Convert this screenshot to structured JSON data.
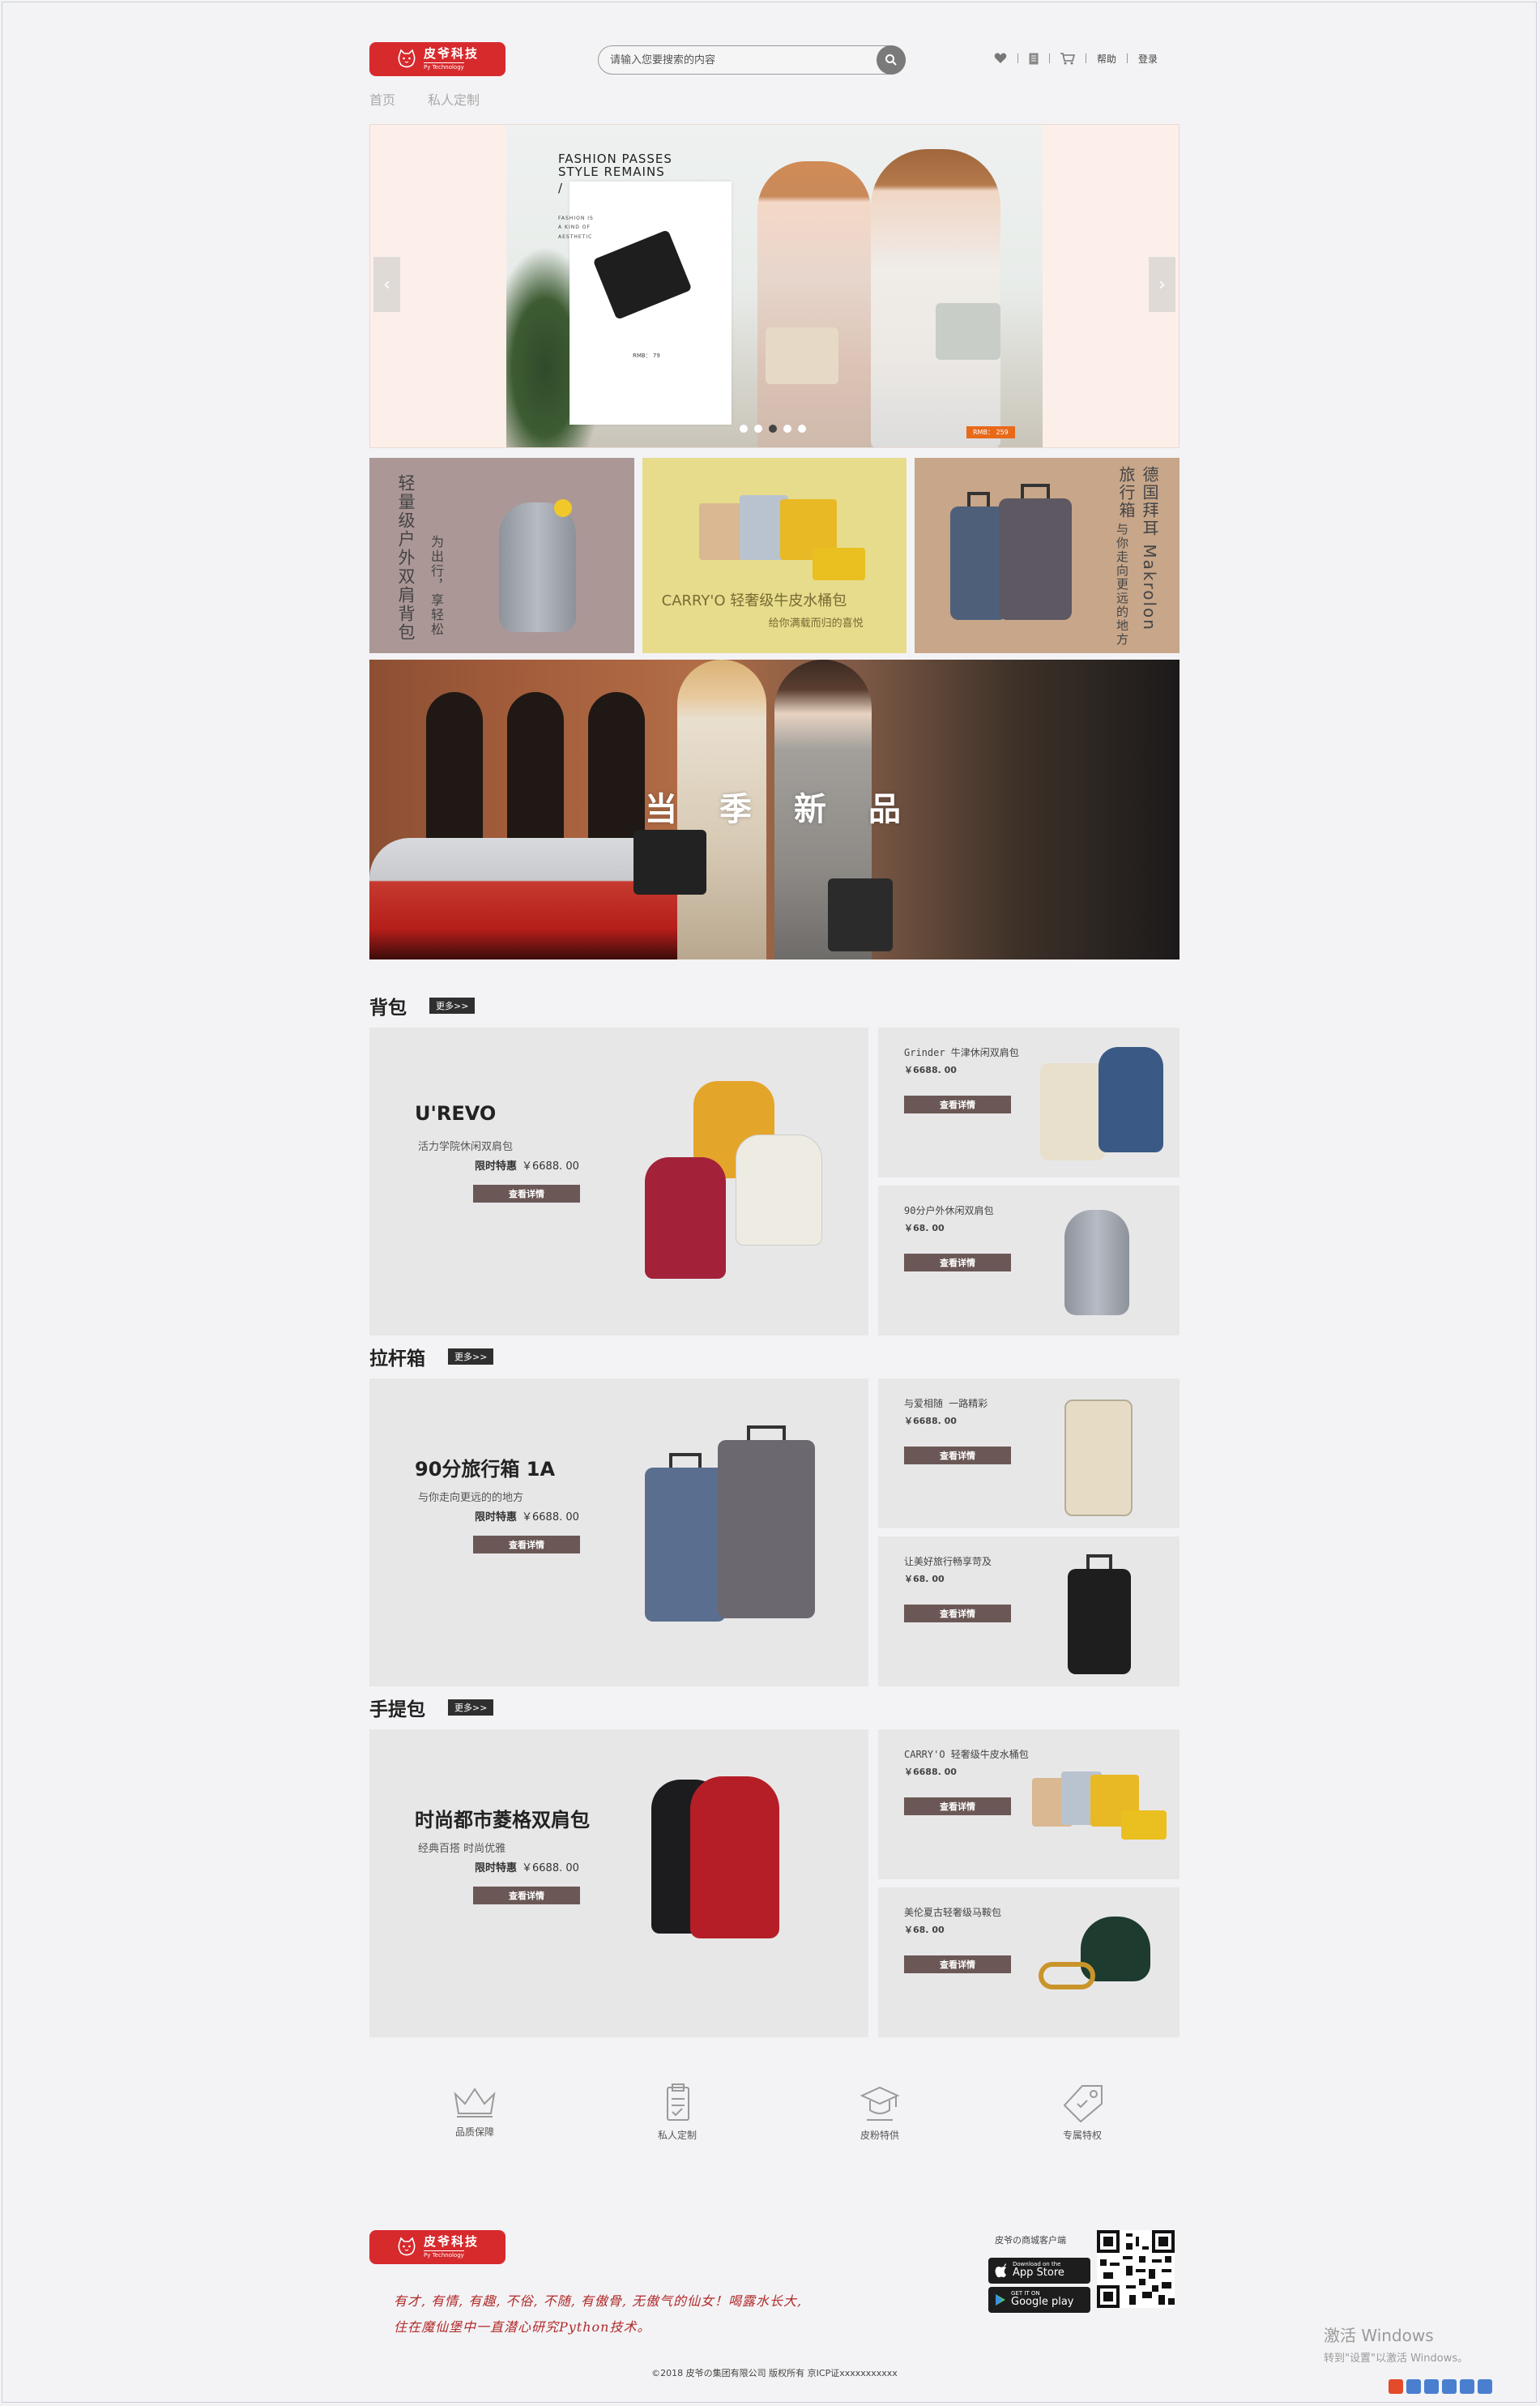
{
  "brand": {
    "name": "皮爷科技",
    "sub": "Py Technology",
    "color": "#d72a2d"
  },
  "search": {
    "placeholder": "请输入您要搜索的内容"
  },
  "top_actions": {
    "help": "帮助",
    "login": "登录"
  },
  "nav": [
    "首页",
    "私人定制"
  ],
  "banner": {
    "headline1": "FASHION PASSES",
    "headline2": "STYLE REMAINS",
    "slash": "/",
    "card_small": [
      "FASHION IS",
      "A KIND OF",
      "AESTHETIC"
    ],
    "card_price": "RMB： 79",
    "tag_price": "RMB： 259",
    "dots": 5,
    "active_dot": 2
  },
  "promos": [
    {
      "v1": "轻量级户外双肩背包",
      "v2": "为出行，享轻松"
    },
    {
      "title": "CARRY'O 轻奢级牛皮水桶包",
      "sub": "给你满载而归的喜悦"
    },
    {
      "v1": "德国拜耳 Makrolon 旅行箱",
      "v2": "与你走向更远的地方"
    }
  ],
  "season_title": [
    "当",
    "季",
    "新",
    "品"
  ],
  "sections": [
    {
      "title": "背包",
      "more": "更多>>",
      "big": {
        "name": "U'REVO",
        "desc": "活力学院休闲双肩包",
        "promo_label": "限时特惠",
        "price": "￥6688. 00",
        "btn": "查看详情"
      },
      "small": [
        {
          "name": "Grinder 牛津休闲双肩包",
          "price": "￥6688. 00",
          "btn": "查看详情"
        },
        {
          "name": "90分户外休闲双肩包",
          "price": "￥68. 00",
          "btn": "查看详情"
        }
      ]
    },
    {
      "title": "拉杆箱",
      "more": "更多>>",
      "big": {
        "name": "90分旅行箱 1A",
        "desc": "与你走向更远的的地方",
        "promo_label": "限时特惠",
        "price": "￥6688. 00",
        "btn": "查看详情"
      },
      "small": [
        {
          "name": "与爱相随 一路精彩",
          "price": "￥6688. 00",
          "btn": "查看详情"
        },
        {
          "name": "让美好旅行畅享苛及",
          "price": "￥68. 00",
          "btn": "查看详情"
        }
      ]
    },
    {
      "title": "手提包",
      "more": "更多>>",
      "big": {
        "name": "时尚都市菱格双肩包",
        "desc": "经典百搭 时尚优雅",
        "promo_label": "限时特惠",
        "price": "￥6688. 00",
        "btn": "查看详情"
      },
      "small": [
        {
          "name": "CARRY'O 轻奢级牛皮水桶包",
          "price": "￥6688. 00",
          "btn": "查看详情"
        },
        {
          "name": "美伦夏古轻奢级马鞍包",
          "price": "￥68. 00",
          "btn": "查看详情"
        }
      ]
    }
  ],
  "features": [
    "品质保障",
    "私人定制",
    "皮粉特供",
    "专属特权"
  ],
  "footer": {
    "slogan1": "有才, 有情, 有趣, 不俗, 不随, 有傲骨, 无傲气的仙女！喝露水长大,",
    "slogan2": "住在魔仙堡中一直潜心研究Python技术。",
    "client_title": "皮爷の商城客户端",
    "appstore_small": "Download on the",
    "appstore_big": "App Store",
    "gplay_small": "GET IT ON",
    "gplay_big": "Google play",
    "copyright": "©2018 皮爷の集团有限公司 版权所有 京ICP证xxxxxxxxxxx"
  },
  "watermark": {
    "line1": "激活 Windows",
    "line2": "转到\"设置\"以激活 Windows。"
  }
}
